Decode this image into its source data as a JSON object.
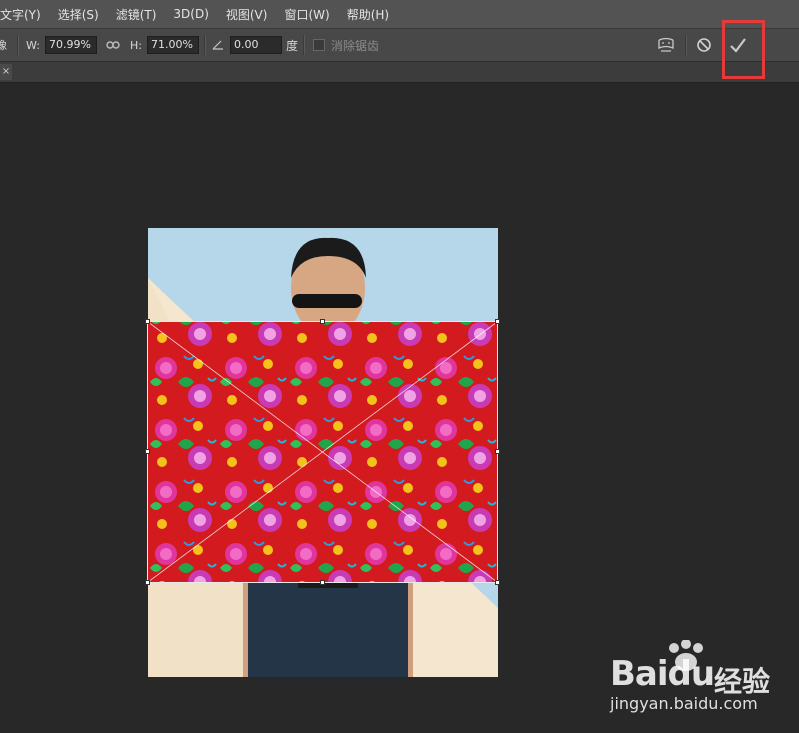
{
  "menubar": {
    "items": [
      {
        "label": "文字(Y)"
      },
      {
        "label": "选择(S)"
      },
      {
        "label": "滤镜(T)"
      },
      {
        "label": "3D(D)"
      },
      {
        "label": "视图(V)"
      },
      {
        "label": "窗口(W)"
      },
      {
        "label": "帮助(H)"
      }
    ]
  },
  "options": {
    "ref_label": "像",
    "w_label": "W:",
    "w_value": "70.99%",
    "h_label": "H:",
    "h_value": "71.00%",
    "angle_value": "0.00",
    "angle_unit": "度",
    "antialias_label": "消除锯齿",
    "antialias_checked": false,
    "warp_icon": "warp-mode-icon",
    "cancel_icon": "cancel-transform-icon",
    "commit_icon": "commit-transform-checkmark-icon"
  },
  "doc_tab": {
    "close_glyph": "×"
  },
  "colors": {
    "highlight": "#e43a3a",
    "canvas_sky": "#b6d6ea",
    "canvas_cream": "#f4e6cf",
    "fabric_red": "#d21a1f"
  },
  "watermark": {
    "logo_bai": "Bai",
    "logo_du": "du",
    "brand": "经验",
    "url": "jingyan.baidu.com"
  }
}
